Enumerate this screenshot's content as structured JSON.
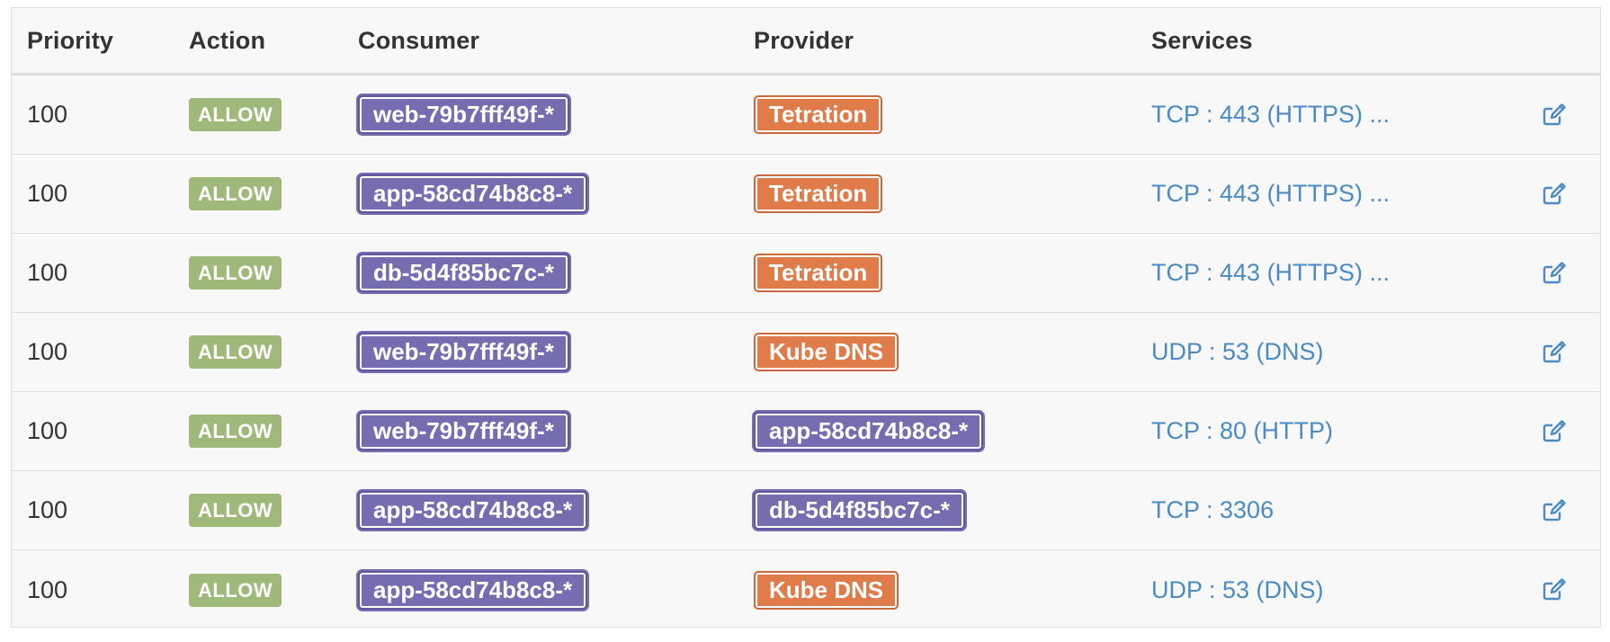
{
  "columns": {
    "priority": "Priority",
    "action": "Action",
    "consumer": "Consumer",
    "provider": "Provider",
    "services": "Services"
  },
  "colors": {
    "allow_badge": "#9eb97a",
    "scope_purple": "#766db1",
    "external_orange": "#e07b4a",
    "link_blue": "#4a8bc6"
  },
  "rows": [
    {
      "priority": "100",
      "action": "ALLOW",
      "consumer": "web-79b7fff49f-*",
      "consumer_color": "purple",
      "provider": "Tetration",
      "provider_color": "orange",
      "services": "TCP : 443 (HTTPS) ...",
      "edit_icon": "edit-icon"
    },
    {
      "priority": "100",
      "action": "ALLOW",
      "consumer": "app-58cd74b8c8-*",
      "consumer_color": "purple",
      "provider": "Tetration",
      "provider_color": "orange",
      "services": "TCP : 443 (HTTPS) ...",
      "edit_icon": "edit-icon"
    },
    {
      "priority": "100",
      "action": "ALLOW",
      "consumer": "db-5d4f85bc7c-*",
      "consumer_color": "purple",
      "provider": "Tetration",
      "provider_color": "orange",
      "services": "TCP : 443 (HTTPS) ...",
      "edit_icon": "edit-icon"
    },
    {
      "priority": "100",
      "action": "ALLOW",
      "consumer": "web-79b7fff49f-*",
      "consumer_color": "purple",
      "provider": "Kube DNS",
      "provider_color": "orange",
      "services": "UDP : 53 (DNS)",
      "edit_icon": "edit-icon"
    },
    {
      "priority": "100",
      "action": "ALLOW",
      "consumer": "web-79b7fff49f-*",
      "consumer_color": "purple",
      "provider": "app-58cd74b8c8-*",
      "provider_color": "purple",
      "services": "TCP : 80 (HTTP)",
      "edit_icon": "edit-icon"
    },
    {
      "priority": "100",
      "action": "ALLOW",
      "consumer": "app-58cd74b8c8-*",
      "consumer_color": "purple",
      "provider": "db-5d4f85bc7c-*",
      "provider_color": "purple",
      "services": "TCP : 3306",
      "edit_icon": "edit-icon"
    },
    {
      "priority": "100",
      "action": "ALLOW",
      "consumer": "app-58cd74b8c8-*",
      "consumer_color": "purple",
      "provider": "Kube DNS",
      "provider_color": "orange",
      "services": "UDP : 53 (DNS)",
      "edit_icon": "edit-icon"
    }
  ]
}
